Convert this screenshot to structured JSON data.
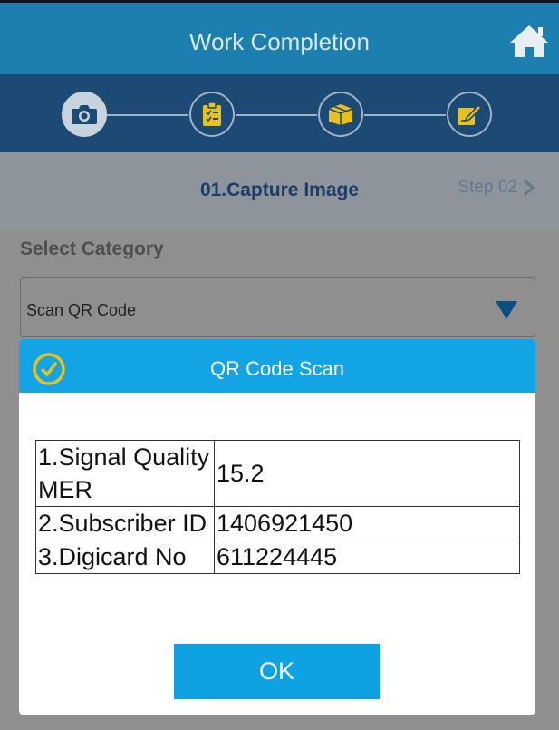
{
  "header": {
    "title": "Work Completion",
    "home_icon": "home-icon"
  },
  "steps": [
    {
      "icon": "camera-icon",
      "active": true
    },
    {
      "icon": "clipboard-icon",
      "active": false
    },
    {
      "icon": "box-icon",
      "active": false
    },
    {
      "icon": "edit-icon",
      "active": false
    }
  ],
  "capture": {
    "title": "01.Capture Image",
    "next_label": "Step 02",
    "next_icon": "chevron-right-icon"
  },
  "category": {
    "label": "Select Category",
    "selected": "Scan QR Code"
  },
  "dialog": {
    "title": "QR Code Scan",
    "rows": [
      {
        "key": "1.Signal Quality MER",
        "value": "15.2"
      },
      {
        "key": "2.Subscriber ID",
        "value": "1406921450"
      },
      {
        "key": "3.Digicard No",
        "value": "611224445"
      }
    ],
    "ok_label": "OK"
  },
  "colors": {
    "header": "#1c7fb0",
    "stepbar": "#1d4a74",
    "accent": "#12a4e4",
    "icon_yellow": "#e8c21a"
  }
}
